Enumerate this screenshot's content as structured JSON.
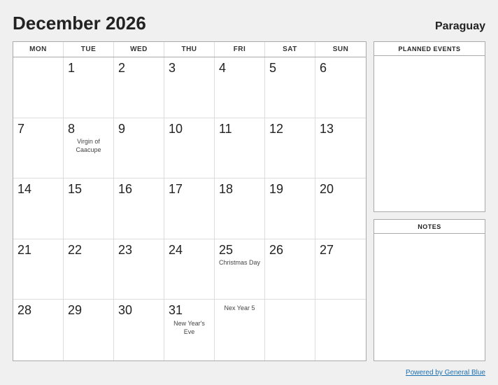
{
  "header": {
    "title": "December 2026",
    "country": "Paraguay"
  },
  "calendar": {
    "day_headers": [
      "MON",
      "TUE",
      "WED",
      "THU",
      "FRI",
      "SAT",
      "SUN"
    ],
    "weeks": [
      [
        {
          "num": "",
          "event": "",
          "empty": true
        },
        {
          "num": "1",
          "event": ""
        },
        {
          "num": "2",
          "event": ""
        },
        {
          "num": "3",
          "event": ""
        },
        {
          "num": "4",
          "event": ""
        },
        {
          "num": "5",
          "event": ""
        },
        {
          "num": "6",
          "event": ""
        }
      ],
      [
        {
          "num": "7",
          "event": ""
        },
        {
          "num": "8",
          "event": "Virgin of\nCaacupe"
        },
        {
          "num": "9",
          "event": ""
        },
        {
          "num": "10",
          "event": ""
        },
        {
          "num": "11",
          "event": ""
        },
        {
          "num": "12",
          "event": ""
        },
        {
          "num": "13",
          "event": ""
        }
      ],
      [
        {
          "num": "14",
          "event": ""
        },
        {
          "num": "15",
          "event": ""
        },
        {
          "num": "16",
          "event": ""
        },
        {
          "num": "17",
          "event": ""
        },
        {
          "num": "18",
          "event": ""
        },
        {
          "num": "19",
          "event": ""
        },
        {
          "num": "20",
          "event": ""
        }
      ],
      [
        {
          "num": "21",
          "event": ""
        },
        {
          "num": "22",
          "event": ""
        },
        {
          "num": "23",
          "event": ""
        },
        {
          "num": "24",
          "event": ""
        },
        {
          "num": "25",
          "event": "Christmas Day"
        },
        {
          "num": "26",
          "event": ""
        },
        {
          "num": "27",
          "event": ""
        }
      ],
      [
        {
          "num": "28",
          "event": ""
        },
        {
          "num": "29",
          "event": ""
        },
        {
          "num": "30",
          "event": ""
        },
        {
          "num": "31",
          "event": "New Year's\nEve"
        },
        {
          "num": "",
          "event": "Nex Year 5",
          "nex": true
        },
        {
          "num": "",
          "event": ""
        },
        {
          "num": "",
          "event": ""
        }
      ]
    ]
  },
  "sidebar": {
    "planned_events_label": "PLANNED EVENTS",
    "notes_label": "NOTES"
  },
  "footer": {
    "link_text": "Powered by General Blue"
  }
}
